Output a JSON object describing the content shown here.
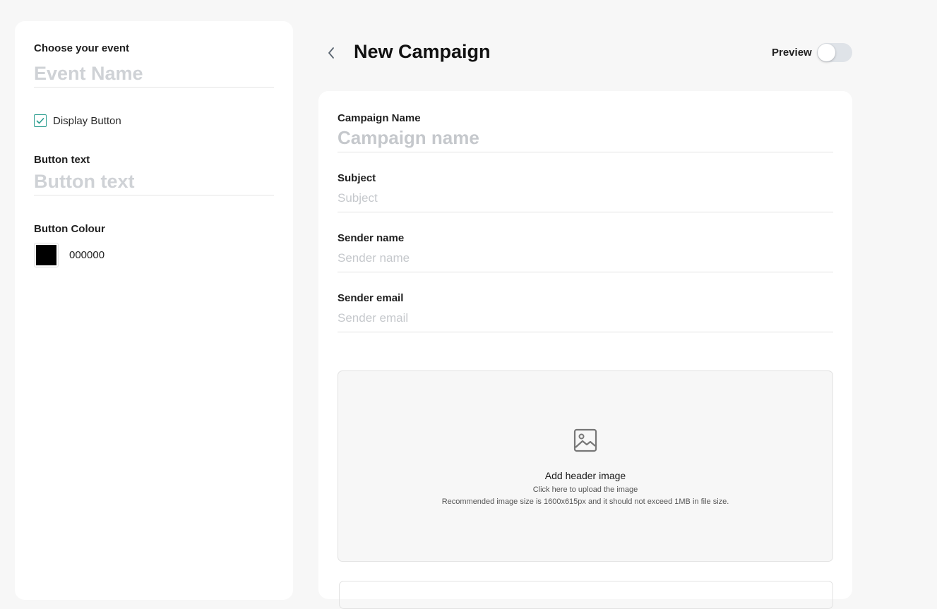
{
  "sidebar": {
    "event_label": "Choose your event",
    "event_placeholder": "Event Name",
    "display_button_label": "Display Button",
    "display_button_checked": true,
    "button_text_label": "Button text",
    "button_text_placeholder": "Button text",
    "button_colour_label": "Button Colour",
    "button_colour_value": "000000"
  },
  "header": {
    "title": "New Campaign",
    "back_icon": "chevron-left-icon",
    "preview_label": "Preview",
    "preview_enabled": false
  },
  "form": {
    "campaign_name_label": "Campaign Name",
    "campaign_name_placeholder": "Campaign name",
    "subject_label": "Subject",
    "subject_placeholder": "Subject",
    "sender_name_label": "Sender name",
    "sender_name_placeholder": "Sender name",
    "sender_email_label": "Sender email",
    "sender_email_placeholder": "Sender email"
  },
  "upload": {
    "icon": "image-icon",
    "title": "Add header image",
    "hint": "Click here to upload the image",
    "recommendation": "Recommended image size is 1600x615px and it should not exceed 1MB in file size."
  },
  "colors": {
    "accent": "#2a9d8f",
    "page_background": "#f7f7f7",
    "card_background": "#ffffff",
    "button_colour": "#000000"
  }
}
